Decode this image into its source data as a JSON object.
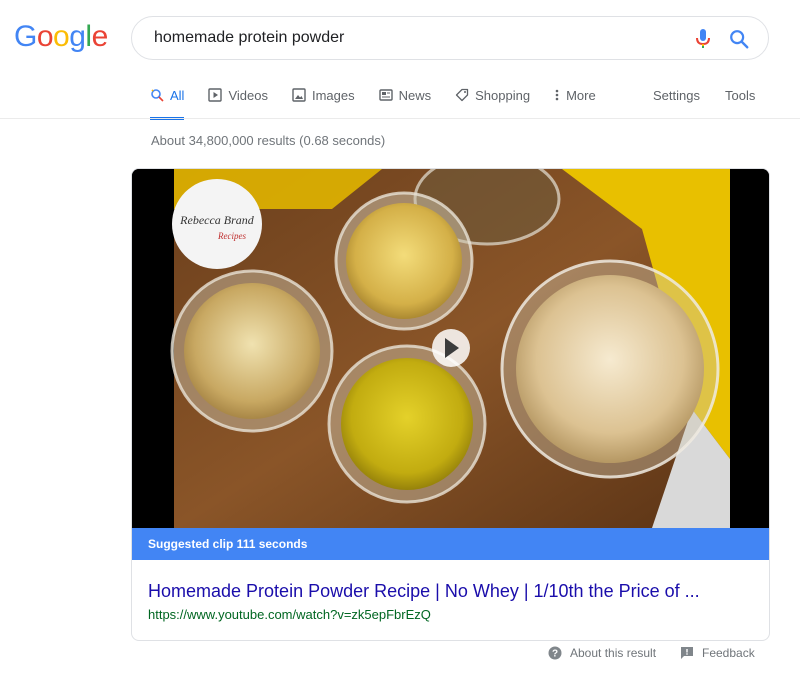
{
  "logo": {
    "letters": [
      "G",
      "o",
      "o",
      "g",
      "l",
      "e"
    ]
  },
  "search": {
    "query": "homemade protein powder"
  },
  "tabs": [
    {
      "label": "All",
      "icon": "search-icon"
    },
    {
      "label": "Videos",
      "icon": "video-icon"
    },
    {
      "label": "Images",
      "icon": "image-icon"
    },
    {
      "label": "News",
      "icon": "news-icon"
    },
    {
      "label": "Shopping",
      "icon": "tag-icon"
    },
    {
      "label": "More",
      "icon": "more-dots-icon"
    }
  ],
  "tools": {
    "settings": "Settings",
    "tools": "Tools"
  },
  "stats": "About 34,800,000 results (0.68 seconds)",
  "video": {
    "clip_label": "Suggested clip 111 seconds",
    "watermark_line1": "Rebecca Brand",
    "watermark_line2": "Recipes"
  },
  "result": {
    "title": "Homemade Protein Powder Recipe | No Whey | 1/10th the Price of ...",
    "url": "https://www.youtube.com/watch?v=zk5epFbrEzQ"
  },
  "footer": {
    "about": "About this result",
    "feedback": "Feedback"
  },
  "colors": {
    "accent": "#1a73e8",
    "link": "#1a0dab",
    "url": "#006621",
    "clip_bar": "#4285f4"
  }
}
